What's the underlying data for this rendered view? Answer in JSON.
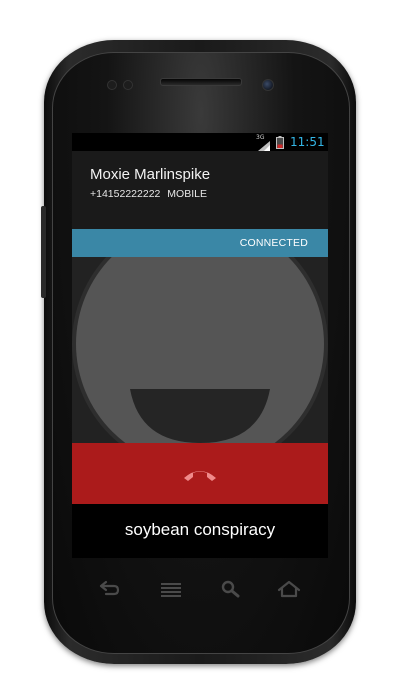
{
  "status_bar": {
    "network_type": "3G",
    "time": "11:51",
    "signal_icon": "signal-bars-icon",
    "battery_icon": "battery-low-icon"
  },
  "caller": {
    "name": "Moxie Marlinspike",
    "number": "+14152222222",
    "number_type": "MOBILE"
  },
  "call": {
    "state": "CONNECTED",
    "end_call_icon": "phone-hangup-icon"
  },
  "caption": "soybean conspiracy",
  "softkeys": [
    {
      "name": "back",
      "icon": "back-arrow-icon"
    },
    {
      "name": "menu",
      "icon": "menu-icon"
    },
    {
      "name": "search",
      "icon": "search-icon"
    },
    {
      "name": "home",
      "icon": "home-icon"
    }
  ],
  "colors": {
    "accent_clock": "#33b5e5",
    "status_strip": "#3a87a6",
    "end_call": "#ab1b1b",
    "end_call_icon": "#f08a8a"
  }
}
